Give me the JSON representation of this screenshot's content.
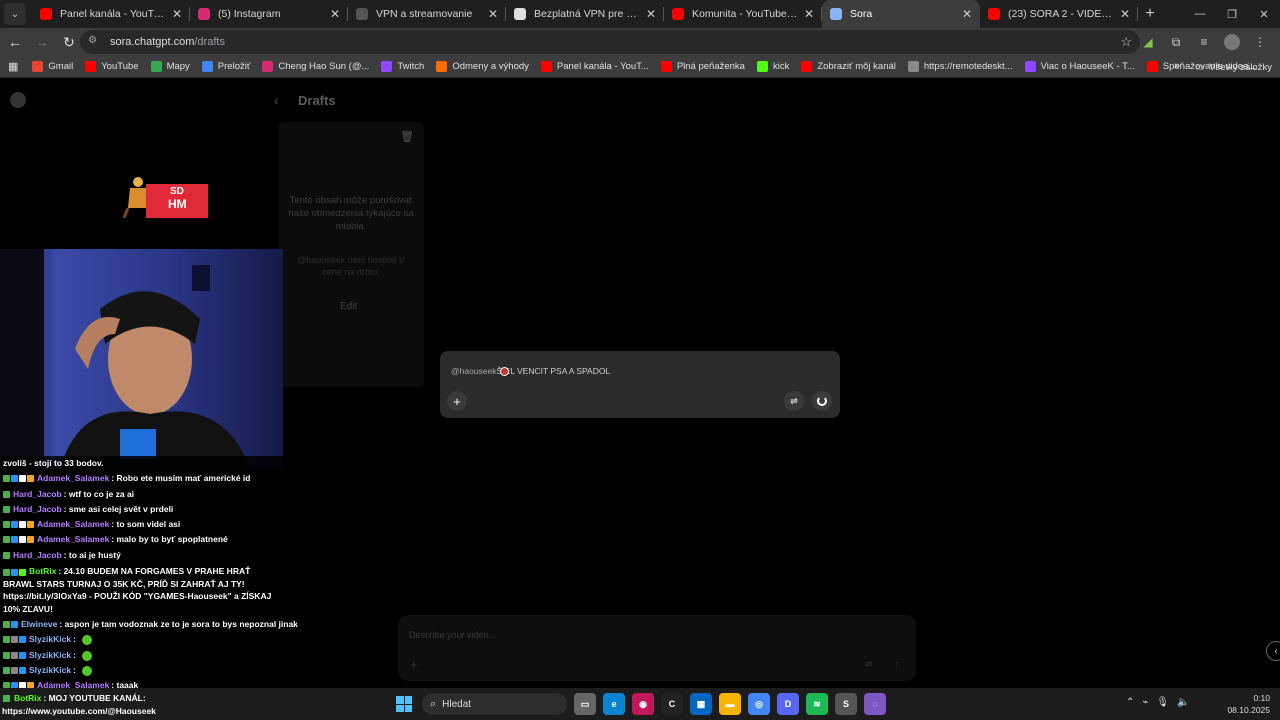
{
  "tabs": [
    {
      "label": "Panel kanála - YouTube Studio",
      "icon": "youtube-icon",
      "color": "#ff0000",
      "active": false
    },
    {
      "label": "(5) Instagram",
      "icon": "instagram-icon",
      "color": "#d62976",
      "active": false
    },
    {
      "label": "VPN a streamovanie",
      "icon": "globe-icon",
      "color": "#555555",
      "active": false
    },
    {
      "label": "Bezplatná VPN pre Chrome - V",
      "icon": "vpn-icon",
      "color": "#e0e0e0",
      "active": false
    },
    {
      "label": "Komunita - YouTube Studio",
      "icon": "youtube-icon",
      "color": "#ff0000",
      "active": false
    },
    {
      "label": "Sora",
      "icon": "sora-icon",
      "color": "#8ab4f8",
      "active": true
    },
    {
      "label": "(23) SORA 2 - VIDEÁ OD VÁS",
      "icon": "youtube-icon",
      "color": "#ff0000",
      "active": false
    }
  ],
  "address": {
    "domain": "sora.chatgpt.com",
    "path": "/drafts"
  },
  "bookmarks": [
    {
      "label": "Gmail",
      "color": "#ea4335"
    },
    {
      "label": "YouTube",
      "color": "#ff0000"
    },
    {
      "label": "Mapy",
      "color": "#34a853"
    },
    {
      "label": "Preložiť",
      "color": "#4285f4"
    },
    {
      "label": "Cheng Hao Sun (@...",
      "color": "#d62976"
    },
    {
      "label": "Twitch",
      "color": "#9146ff"
    },
    {
      "label": "Odmeny a výhody",
      "color": "#ff6b00"
    },
    {
      "label": "Panel kanála - YouT...",
      "color": "#ff0000"
    },
    {
      "label": "Plná peňaženka",
      "color": "#ff0000"
    },
    {
      "label": "kick",
      "color": "#53fc18"
    },
    {
      "label": "Zobraziť môj kanál",
      "color": "#ff0000"
    },
    {
      "label": "https://remotedeskt...",
      "color": "#888888"
    },
    {
      "label": "Viac o HaouseeK - T...",
      "color": "#9146ff"
    },
    {
      "label": "Speňažovanie videa...",
      "color": "#ff0000"
    }
  ],
  "bookmarks_all": "Všetky záložky",
  "drafts": {
    "title": "Drafts",
    "card_text": "Tento obsah môže porušovať naše obmedzenia týkajúce sa mlobia.",
    "card_hint": "@haouseek není hostitel V cene na drôtu.",
    "edit_label": "Edit"
  },
  "overlay": {
    "line1": "SD",
    "line2": "HM"
  },
  "chat": [
    {
      "user": "",
      "text": "zvolíš - stojí to 33 bodov.",
      "user_color": "#ffffff",
      "badges": []
    },
    {
      "user": "Adamek_Salamek",
      "text": ": Robo ete musím mať americké id",
      "user_color": "#b57cff",
      "badges": [
        "#4caf50",
        "#2196f3",
        "#ffffff",
        "#f5a623"
      ]
    },
    {
      "user": "Hard_Jacob",
      "text": ": wtf to co je za ai",
      "user_color": "#b57cff",
      "badges": [
        "#4caf50"
      ]
    },
    {
      "user": "Hard_Jacob",
      "text": ": sme asi celej svět v prdeli",
      "user_color": "#b57cff",
      "badges": [
        "#4caf50"
      ]
    },
    {
      "user": "Adamek_Salamek",
      "text": ": to som videl asi",
      "user_color": "#b57cff",
      "badges": [
        "#4caf50",
        "#2196f3",
        "#ffffff",
        "#f5a623"
      ]
    },
    {
      "user": "Adamek_Salamek",
      "text": ": malo by to byť spoplatnené",
      "user_color": "#b57cff",
      "badges": [
        "#4caf50",
        "#2196f3",
        "#ffffff",
        "#f5a623"
      ]
    },
    {
      "user": "Hard_Jacob",
      "text": ": to ai je hustý",
      "user_color": "#b57cff",
      "badges": [
        "#4caf50"
      ]
    },
    {
      "user": "BotRix",
      "text": ": 24.10 BUDEM NA FORGAMES V PRAHE HRAŤ BRAWL STARS TURNAJ O 35K KČ, PRÍĎ SI ZAHRAŤ AJ TY! https://bit.ly/3lOxYa9 - POUŽI KÓD \"YGAMES-Haouseek\" a ZÍSKAJ 10% ZĽAVU!",
      "user_color": "#53fc18",
      "badges": [
        "#4caf50",
        "#2196f3",
        "#53fc18"
      ],
      "wrap": true
    },
    {
      "user": "Elwineve",
      "text": ": aspon je tam vodoznak ze to je sora to bys nepoznal jinak",
      "user_color": "#8ab4f8",
      "badges": [
        "#4caf50",
        "#2196f3"
      ]
    },
    {
      "user": "SlyzikKick",
      "text": ":",
      "user_color": "#8ab4f8",
      "badges": [
        "#4caf50",
        "#888888",
        "#2196f3"
      ],
      "emote": true
    },
    {
      "user": "SlyzikKick",
      "text": ":",
      "user_color": "#8ab4f8",
      "badges": [
        "#4caf50",
        "#888888",
        "#2196f3"
      ],
      "emote": true
    },
    {
      "user": "SlyzikKick",
      "text": ":",
      "user_color": "#8ab4f8",
      "badges": [
        "#4caf50",
        "#888888",
        "#2196f3"
      ],
      "emote": true
    },
    {
      "user": "Adamek_Salamek",
      "text": ": taaak",
      "user_color": "#b57cff",
      "badges": [
        "#4caf50",
        "#2196f3",
        "#ffffff",
        "#f5a623"
      ]
    }
  ],
  "chat_last": {
    "user": "BotRix",
    "text": ": MOJ YOUTUBE KANÁL:",
    "url": "https://www.youtube.com/@Haouseek"
  },
  "prompt": {
    "mention": "@haouseek",
    "text": "ŠIEL VENCIT PSA A SPADOL"
  },
  "bottom_input": {
    "placeholder": "Describe your video..."
  },
  "taskbar": {
    "search_label": "Hledat",
    "apps": [
      {
        "name": "file-manager",
        "color": "#666666",
        "glyph": "▭"
      },
      {
        "name": "edge",
        "color": "#0a84d0",
        "glyph": "e"
      },
      {
        "name": "color-app",
        "color": "#c2185b",
        "glyph": "◉"
      },
      {
        "name": "ctrl-app",
        "color": "#222222",
        "glyph": "C"
      },
      {
        "name": "store",
        "color": "#0067c0",
        "glyph": "▦"
      },
      {
        "name": "explorer",
        "color": "#f4b400",
        "glyph": "▬"
      },
      {
        "name": "chrome",
        "color": "#4285f4",
        "glyph": "◎"
      },
      {
        "name": "discord",
        "color": "#5865f2",
        "glyph": "D"
      },
      {
        "name": "spotify",
        "color": "#1db954",
        "glyph": "≋"
      },
      {
        "name": "steam",
        "color": "#555555",
        "glyph": "S"
      },
      {
        "name": "obs",
        "color": "#7e57c2",
        "glyph": "◌"
      }
    ],
    "time": "0:10",
    "date": "08.10.2025"
  }
}
